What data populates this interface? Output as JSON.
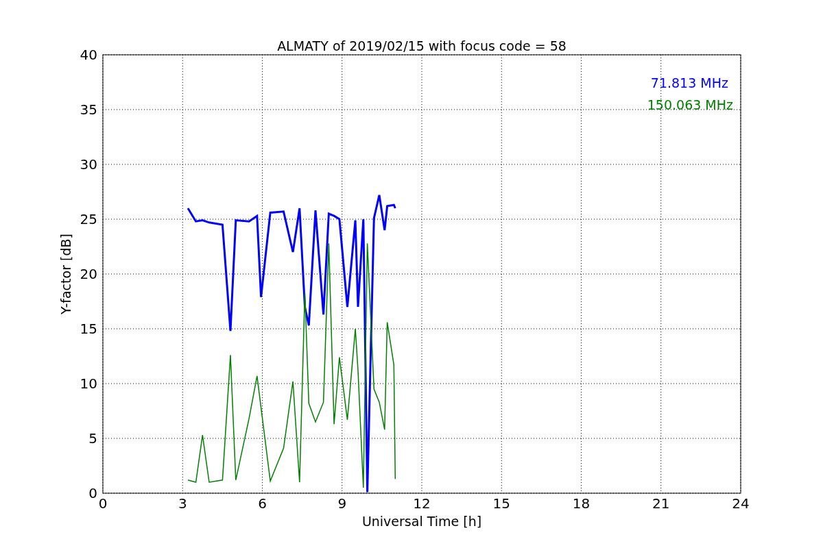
{
  "chart_data": {
    "type": "line",
    "title": "ALMATY of 2019/02/15 with focus code = 58",
    "xlabel": "Universal Time [h]",
    "ylabel": "Y-factor [dB]",
    "x": [
      3.2,
      3.5,
      3.75,
      4.0,
      4.5,
      4.8,
      5.0,
      5.5,
      5.8,
      5.95,
      6.3,
      6.8,
      7.15,
      7.4,
      7.6,
      7.75,
      8.0,
      8.3,
      8.5,
      8.7,
      8.9,
      9.2,
      9.5,
      9.6,
      9.8,
      9.95,
      10.2,
      10.4,
      10.6,
      10.7,
      10.95,
      11.0
    ],
    "series": [
      {
        "name": "71.813 MHz",
        "color": "#0000ff",
        "values": [
          26,
          24.8,
          24.9,
          24.7,
          24.5,
          14.8,
          24.9,
          24.8,
          25.3,
          17.9,
          25.6,
          25.7,
          22,
          26,
          17,
          15.3,
          25.8,
          16.3,
          25.5,
          25.3,
          25,
          17,
          24.9,
          17,
          25,
          0.1,
          25.1,
          27.2,
          24,
          26.2,
          26.3,
          26
        ]
      },
      {
        "name": "150.063 MHz",
        "color": "#008000",
        "values": [
          1.2,
          1,
          5.3,
          1,
          1.2,
          12.6,
          1.2,
          6.8,
          10.7,
          7.8,
          1.1,
          4.1,
          10.2,
          1,
          18.3,
          8.2,
          6.5,
          8.3,
          22.8,
          6.3,
          12.4,
          6.7,
          15,
          11.2,
          0.5,
          22.8,
          9.5,
          8.3,
          5.8,
          15.6,
          11.7,
          1.3
        ]
      }
    ],
    "grid": true,
    "xlim": [
      0,
      24
    ],
    "ylim": [
      0,
      40
    ],
    "xticks": [
      0,
      3,
      6,
      9,
      12,
      15,
      18,
      21,
      24
    ],
    "yticks": [
      0,
      5,
      10,
      15,
      20,
      25,
      30,
      35,
      40
    ]
  }
}
